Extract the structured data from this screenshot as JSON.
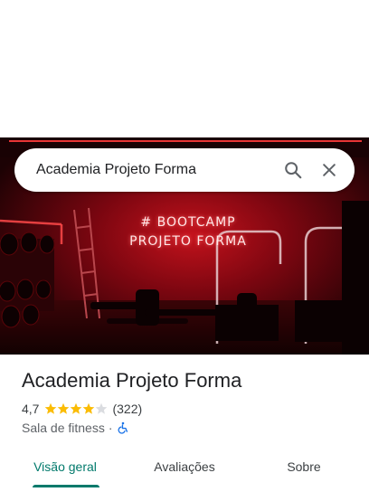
{
  "search": {
    "query": "Academia Projeto Forma",
    "search_icon": "search-icon",
    "close_icon": "close-icon"
  },
  "hero": {
    "neon_line1": "# BOOTCAMP",
    "neon_line2": "PROJETO FORMA"
  },
  "place": {
    "name": "Academia Projeto Forma",
    "rating": "4,7",
    "rating_value": 4.7,
    "review_count": "(322)",
    "category": "Sala de fitness",
    "separator": "·",
    "accessibility_icon": "wheelchair-icon"
  },
  "tabs": [
    {
      "label": "Visão geral",
      "active": true
    },
    {
      "label": "Avaliações",
      "active": false
    },
    {
      "label": "Sobre",
      "active": false
    }
  ],
  "colors": {
    "accent": "#00796b",
    "star": "#fbbc04",
    "accessibility": "#1a73e8"
  }
}
